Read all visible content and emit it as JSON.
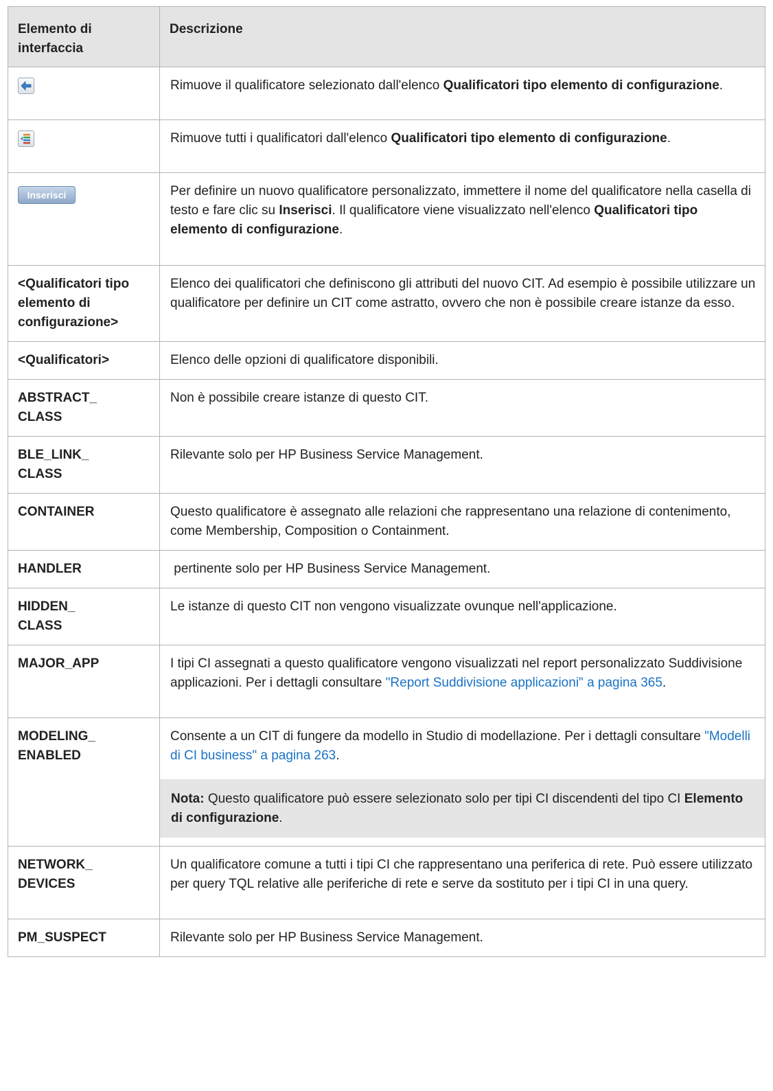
{
  "table": {
    "header": {
      "col1": "Elemento di interfaccia",
      "col2": "Descrizione"
    },
    "rows": {
      "r0": {
        "icon": "remove-selected-arrow-icon",
        "d1": "Rimuove il qualificatore selezionato dall'elenco ",
        "d2": "Qualificatori tipo elemento di configurazione",
        "d3": "."
      },
      "r1": {
        "icon": "remove-all-icon",
        "d1": "Rimuove tutti i qualificatori dall'elenco ",
        "d2": "Qualificatori tipo elemento di configurazione",
        "d3": "."
      },
      "r2": {
        "button_label": "Inserisci",
        "d1": "Per definire un nuovo qualificatore personalizzato, immettere il nome del qualificatore nella casella di testo e fare clic su ",
        "d2": "Inserisci",
        "d3": ". Il qualificatore viene visualizzato nell'elenco ",
        "d4": "Qualificatori tipo elemento di configurazione",
        "d5": "."
      },
      "r3": {
        "name": "<Qualificatori tipo elemento di configurazione>",
        "desc": "Elenco dei qualificatori che definiscono gli attributi del nuovo CIT. Ad esempio è possibile utilizzare un qualificatore per definire un CIT come astratto, ovvero che non è possibile creare istanze da esso."
      },
      "r4": {
        "name": "<Qualificatori>",
        "desc": "Elenco delle opzioni di qualificatore disponibili."
      },
      "r5": {
        "name1": "ABSTRACT_",
        "name2": "CLASS",
        "desc": "Non è possibile creare istanze di questo CIT."
      },
      "r6": {
        "name1": "BLE_LINK_",
        "name2": "CLASS",
        "desc": "Rilevante solo per HP Business Service Management."
      },
      "r7": {
        "name": "CONTAINER",
        "desc": "Questo qualificatore è assegnato alle relazioni che rappresentano una relazione di contenimento, come Membership, Composition o Containment."
      },
      "r8": {
        "name": "HANDLER",
        "desc": " pertinente solo per HP Business Service Management."
      },
      "r9": {
        "name1": "HIDDEN_",
        "name2": "CLASS",
        "desc": "Le istanze di questo CIT non vengono visualizzate ovunque nell'applicazione."
      },
      "r10": {
        "name": "MAJOR_APP",
        "desc": "I tipi CI assegnati a questo qualificatore vengono visualizzati nel report personalizzato Suddivisione applicazioni. Per i dettagli consultare ",
        "link": "\"Report Suddivisione applicazioni\" a pagina 365",
        "end": "."
      },
      "r11": {
        "name1": "MODELING_",
        "name2": "ENABLED",
        "desc": "Consente a un CIT di fungere da modello in Studio di modellazione. Per i dettagli consultare ",
        "link": "\"Modelli di CI business\" a pagina 263",
        "end": ".",
        "note_label": "Nota:",
        "note1": " Questo qualificatore può essere selezionato solo per tipi CI discendenti del tipo CI ",
        "note2": "Elemento di configurazione",
        "note3": "."
      },
      "r12": {
        "name1": "NETWORK_",
        "name2": "DEVICES",
        "desc": "Un qualificatore comune a tutti i tipi CI che rappresentano una periferica di rete. Può essere utilizzato per query TQL relative alle periferiche di rete e serve da sostituto per i tipi CI in una query."
      },
      "r13": {
        "name": "PM_SUSPECT",
        "desc": "Rilevante solo per HP Business Service Management."
      }
    }
  }
}
